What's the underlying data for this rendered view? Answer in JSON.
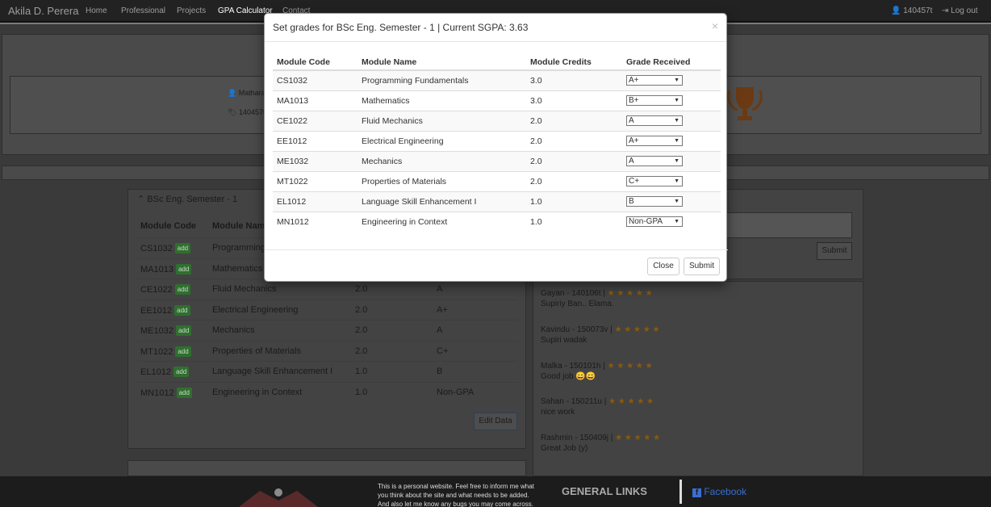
{
  "navbar": {
    "brand": "Akila D. Perera",
    "items": [
      "Home",
      "Professional",
      "Projects",
      "GPA Calculator",
      "Contact"
    ],
    "user": "140457t",
    "logout": "Log out"
  },
  "profile": {
    "name": "Mathara",
    "id": "140457t"
  },
  "semester_panel": {
    "title": "BSc Eng. Semester - 1",
    "headers": [
      "Module Code",
      "Module Name"
    ],
    "add_label": "add",
    "rows": [
      {
        "code": "CS1032",
        "name": "Programming",
        "credits": "",
        "grade": ""
      },
      {
        "code": "MA1013",
        "name": "Mathematics",
        "credits": "",
        "grade": ""
      },
      {
        "code": "CE1022",
        "name": "Fluid Mechanics",
        "credits": "2.0",
        "grade": "A"
      },
      {
        "code": "EE1012",
        "name": "Electrical Engineering",
        "credits": "2.0",
        "grade": "A+"
      },
      {
        "code": "ME1032",
        "name": "Mechanics",
        "credits": "2.0",
        "grade": "A"
      },
      {
        "code": "MT1022",
        "name": "Properties of Materials",
        "credits": "2.0",
        "grade": "C+"
      },
      {
        "code": "EL1012",
        "name": "Language Skill Enhancement I",
        "credits": "1.0",
        "grade": "B"
      },
      {
        "code": "MN1012",
        "name": "Engineering in Context",
        "credits": "1.0",
        "grade": "Non-GPA"
      }
    ],
    "edit_button": "Edit Data"
  },
  "comment_submit": "Submit",
  "comments": [
    {
      "author": "Gayan - 140106t |",
      "text": "Supiriy Ban.. Elama."
    },
    {
      "author": "Kavindu - 150073v |",
      "text": "Supiri wadak"
    },
    {
      "author": "Malka - 150101h |",
      "text": "Good job 😄😄"
    },
    {
      "author": "Sahan - 150211u |",
      "text": "nice work"
    },
    {
      "author": "Rashmin - 150409j |",
      "text": "Great Job (y)"
    }
  ],
  "stars": "★ ★ ★ ★ ★",
  "footer": {
    "note_line1": "This is a personal website. Feel free to inform me what",
    "note_line2": "you think about the site and what needs to be added.",
    "note_line3": "And also let me know any bugs you may come across.",
    "links_title": "GENERAL LINKS",
    "facebook": "Facebook"
  },
  "modal": {
    "title": "Set grades for BSc Eng. Semester - 1 | Current SGPA: 3.63",
    "close_icon": "×",
    "headers": [
      "Module Code",
      "Module Name",
      "Module Credits",
      "Grade Received"
    ],
    "rows": [
      {
        "code": "CS1032",
        "name": "Programming Fundamentals",
        "credits": "3.0",
        "grade": "A+"
      },
      {
        "code": "MA1013",
        "name": "Mathematics",
        "credits": "3.0",
        "grade": "B+"
      },
      {
        "code": "CE1022",
        "name": "Fluid Mechanics",
        "credits": "2.0",
        "grade": "A"
      },
      {
        "code": "EE1012",
        "name": "Electrical Engineering",
        "credits": "2.0",
        "grade": "A+"
      },
      {
        "code": "ME1032",
        "name": "Mechanics",
        "credits": "2.0",
        "grade": "A"
      },
      {
        "code": "MT1022",
        "name": "Properties of Materials",
        "credits": "2.0",
        "grade": "C+"
      },
      {
        "code": "EL1012",
        "name": "Language Skill Enhancement I",
        "credits": "1.0",
        "grade": "B"
      },
      {
        "code": "MN1012",
        "name": "Engineering in Context",
        "credits": "1.0",
        "grade": "Non-GPA"
      }
    ],
    "close_button": "Close",
    "submit_button": "Submit"
  }
}
